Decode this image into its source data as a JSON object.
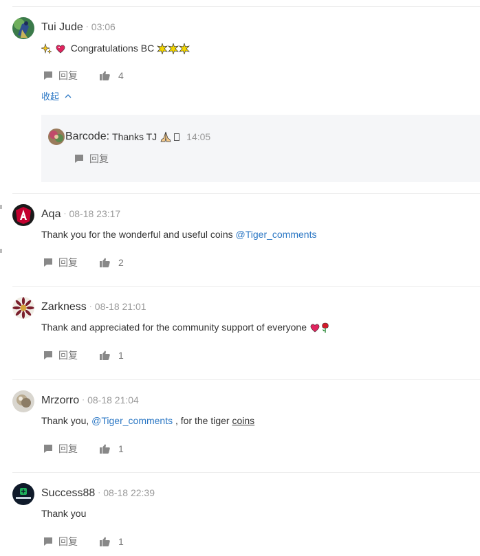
{
  "reply_label": "回复",
  "collapse_label": "收起",
  "comments": [
    {
      "name": "Tui Jude",
      "time": "03:06",
      "text": "Congratulations BC",
      "likes": "4",
      "reply": {
        "name": "Barcode",
        "text": "Thanks TJ",
        "time": "14:05"
      }
    },
    {
      "name": "Aqa",
      "time": "08-18 23:17",
      "text": "Thank you for the wonderful and useful coins ",
      "mention": "@Tiger_comments",
      "likes": "2"
    },
    {
      "name": "Zarkness",
      "time": "08-18 21:01",
      "text": "Thank and appreciated for the community support of everyone",
      "likes": "1"
    },
    {
      "name": "Mrzorro",
      "time": "08-18 21:04",
      "text_before": "Thank you, ",
      "mention": "@Tiger_comments",
      "text_after": " , for the tiger ",
      "link": "coins",
      "likes": "1"
    },
    {
      "name": "Success88",
      "time": "08-18 22:39",
      "text": "Thank you",
      "likes": "1"
    }
  ]
}
